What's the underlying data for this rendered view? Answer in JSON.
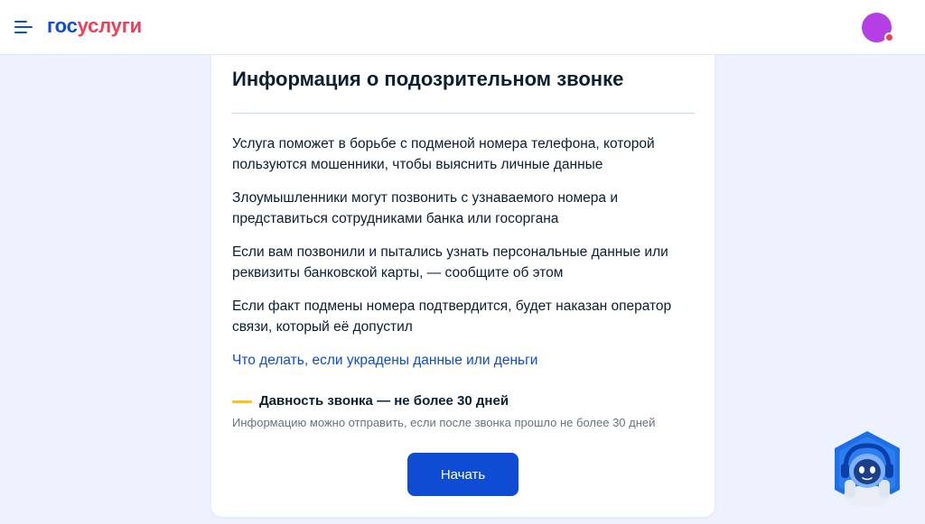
{
  "header": {
    "logo_part1": "гос",
    "logo_part2": "услуги",
    "menu_icon": "hamburger-menu-icon",
    "avatar_icon": "user-avatar",
    "colors": {
      "brand_blue": "#0d4cd3",
      "brand_red": "#ee3f58",
      "avatar": "#b43fe5"
    }
  },
  "card": {
    "title": "Информация о подозрительном звонке",
    "paragraphs": [
      "Услуга поможет в борьбе с подменой номера телефона, которой пользуются мошенники, чтобы выяснить личные данные",
      "Злоумышленники могут позвонить с узнаваемого номера и представиться сотрудниками банка или госоргана",
      "Если вам позвонили и пытались узнать персональные данные или реквизиты банковской карты, — сообщите об этом",
      "Если факт подмены номера подтвердится, будет наказан оператор связи, который её допустил"
    ],
    "link": "Что делать, если украдены данные или деньги",
    "notice": {
      "title": "Давность звонка — не более 30 дней",
      "text": "Информацию можно отправить, если после звонка прошло не более 30 дней",
      "accent_color": "#fcc417"
    },
    "start_button": "Начать"
  },
  "assistant": {
    "icon": "robot-assistant-icon"
  }
}
